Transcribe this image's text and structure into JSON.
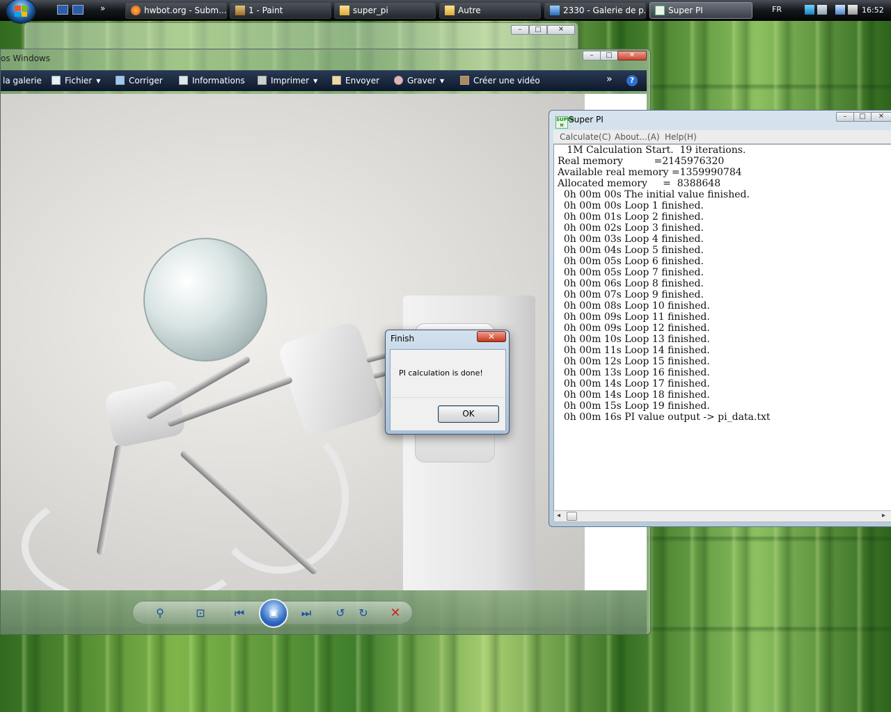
{
  "taskbar": {
    "tasks": [
      {
        "label": "hwbot.org - Subm..."
      },
      {
        "label": "1 - Paint"
      },
      {
        "label": "super_pi"
      },
      {
        "label": "Autre"
      },
      {
        "label": "2330 - Galerie de p..."
      },
      {
        "label": "Super PI"
      }
    ],
    "quick_launch_more": "»",
    "language": "FR",
    "clock": "16:52"
  },
  "gallery": {
    "title_fragment": "os Windows",
    "toolbar": {
      "gallery": "la galerie",
      "file": "Fichier",
      "fix": "Corriger",
      "info": "Informations",
      "print": "Imprimer",
      "send": "Envoyer",
      "burn": "Graver",
      "video": "Créer une vidéo",
      "more": "»",
      "help": "?"
    },
    "window_controls": {
      "minimize": "–",
      "maximize": "□",
      "close": "✕"
    }
  },
  "superpi": {
    "title": "Super PI",
    "logo": "SUPER π",
    "menu": {
      "calculate": "Calculate(C)",
      "about": "About...(A)",
      "help": "Help(H)"
    },
    "window_controls": {
      "minimize": "–",
      "maximize": "□",
      "close": "✕"
    },
    "log": [
      "   1M Calculation Start.  19 iterations.",
      "Real memory          =2145976320",
      "Available real memory =1359990784",
      "Allocated memory     =  8388648",
      "  0h 00m 00s The initial value finished.",
      "  0h 00m 00s Loop 1 finished.",
      "  0h 00m 01s Loop 2 finished.",
      "  0h 00m 02s Loop 3 finished.",
      "  0h 00m 03s Loop 4 finished.",
      "  0h 00m 04s Loop 5 finished.",
      "  0h 00m 05s Loop 6 finished.",
      "  0h 00m 05s Loop 7 finished.",
      "  0h 00m 06s Loop 8 finished.",
      "  0h 00m 07s Loop 9 finished.",
      "  0h 00m 08s Loop 10 finished.",
      "  0h 00m 09s Loop 11 finished.",
      "  0h 00m 09s Loop 12 finished.",
      "  0h 00m 10s Loop 13 finished.",
      "  0h 00m 11s Loop 14 finished.",
      "  0h 00m 12s Loop 15 finished.",
      "  0h 00m 13s Loop 16 finished.",
      "  0h 00m 14s Loop 17 finished.",
      "  0h 00m 14s Loop 18 finished.",
      "  0h 00m 15s Loop 19 finished.",
      "  0h 00m 16s PI value output -> pi_data.txt"
    ],
    "scroll": {
      "left": "◂",
      "right": "▸"
    }
  },
  "dialog": {
    "title": "Finish",
    "close": "✕",
    "message": "PI calculation is done!",
    "ok": "OK"
  },
  "viewer_controls": {
    "zoom": "⚲",
    "fit": "⊡",
    "prev": "⏮",
    "slideshow": "▣",
    "next": "⏭",
    "rotate_left": "↺",
    "rotate_right": "↻",
    "delete": "✕"
  },
  "colors": {
    "taskbar": "#15181c",
    "toolbar": "#0d1829",
    "dialog_close": "#c5371f",
    "delete": "#d42020"
  }
}
